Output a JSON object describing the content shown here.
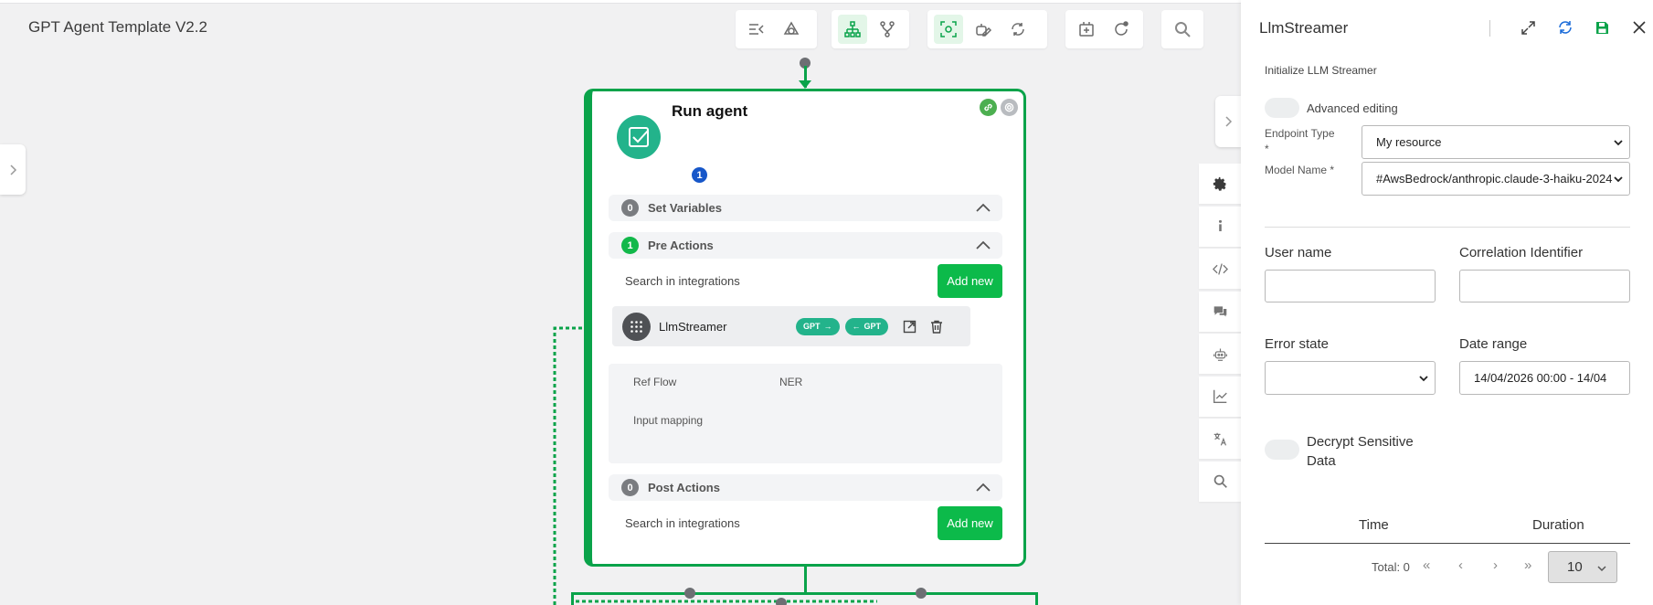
{
  "app": {
    "title": "GPT Agent Template V2.2"
  },
  "node": {
    "title": "Run agent",
    "badge": "1",
    "sections": {
      "set_variables": {
        "count": "0",
        "label": "Set Variables"
      },
      "pre_actions": {
        "count": "1",
        "label": "Pre Actions"
      },
      "post_actions": {
        "count": "0",
        "label": "Post Actions"
      }
    },
    "pre_search_placeholder": "Search in integrations",
    "post_search_placeholder": "Search in integrations",
    "add_new_label": "Add new",
    "integration": {
      "name": "LlmStreamer",
      "pill_out": "GPT",
      "pill_in": "GPT"
    },
    "details": {
      "ref_flow_label": "Ref Flow",
      "ref_flow_value": "NER",
      "input_mapping_label": "Input mapping"
    }
  },
  "panel": {
    "title": "LlmStreamer",
    "subtitle": "Initialize LLM Streamer",
    "advanced_editing": "Advanced editing",
    "endpoint_type_label": "Endpoint Type *",
    "endpoint_type_value": "My resource",
    "model_name_label": "Model Name *",
    "model_name_value": "#AwsBedrock/anthropic.claude-3-haiku-2024",
    "user_name_label": "User name",
    "correlation_label": "Correlation Identifier",
    "error_state_label": "Error state",
    "date_range_label": "Date range",
    "date_range_value": "14/04/2026 00:00 - 14/04",
    "decrypt_label": "Decrypt Sensitive Data",
    "table_headers": [
      "Time",
      "Duration"
    ],
    "total_label": "Total: 0",
    "page_size": "10"
  },
  "colors": {
    "accent": "#0aa34a",
    "add_button": "#0cba4a",
    "node_icon": "#23b38b",
    "badge_blue": "#1757c9"
  }
}
